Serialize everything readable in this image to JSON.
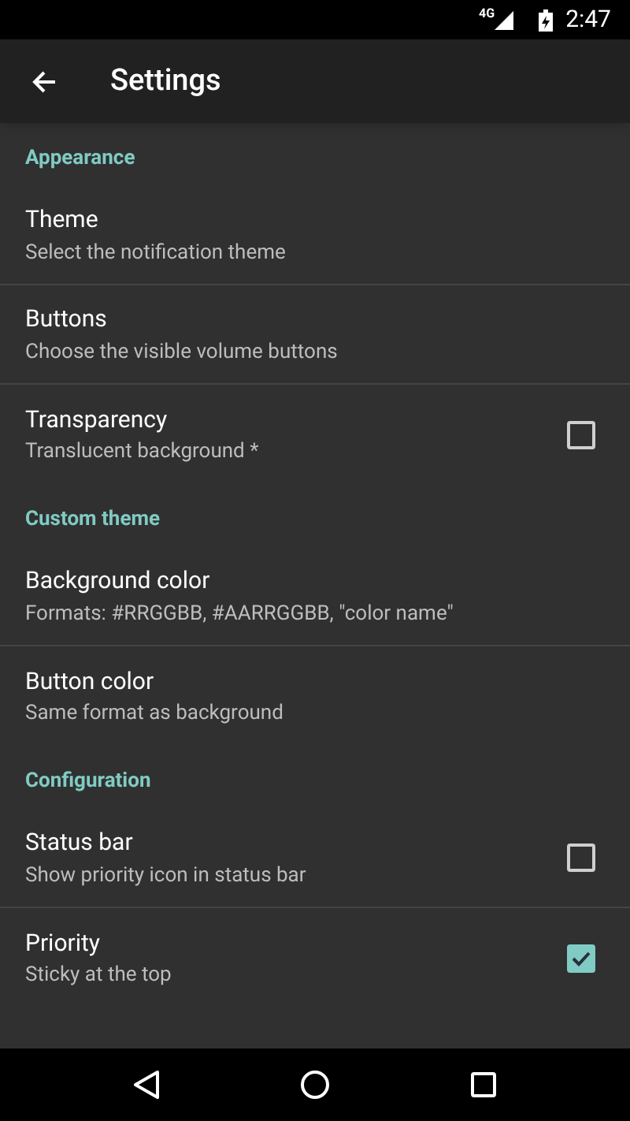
{
  "status_bar": {
    "network": "4G",
    "time": "2:47"
  },
  "app_bar": {
    "title": "Settings"
  },
  "sections": [
    {
      "title": "Appearance",
      "items": [
        {
          "kind": "text",
          "title": "Theme",
          "summary": "Select the notification theme"
        },
        {
          "kind": "text",
          "title": "Buttons",
          "summary": "Choose the visible volume buttons"
        },
        {
          "kind": "checkbox",
          "title": "Transparency",
          "summary": "Translucent background *",
          "checked": false
        }
      ]
    },
    {
      "title": "Custom theme",
      "items": [
        {
          "kind": "text",
          "title": "Background color",
          "summary": "Formats: #RRGGBB, #AARRGGBB, \"color name\""
        },
        {
          "kind": "text",
          "title": "Button color",
          "summary": "Same format as background"
        }
      ]
    },
    {
      "title": "Configuration",
      "items": [
        {
          "kind": "checkbox",
          "title": "Status bar",
          "summary": "Show priority icon in status bar",
          "checked": false
        },
        {
          "kind": "checkbox",
          "title": "Priority",
          "summary": "Sticky at the top",
          "checked": true
        }
      ]
    }
  ]
}
